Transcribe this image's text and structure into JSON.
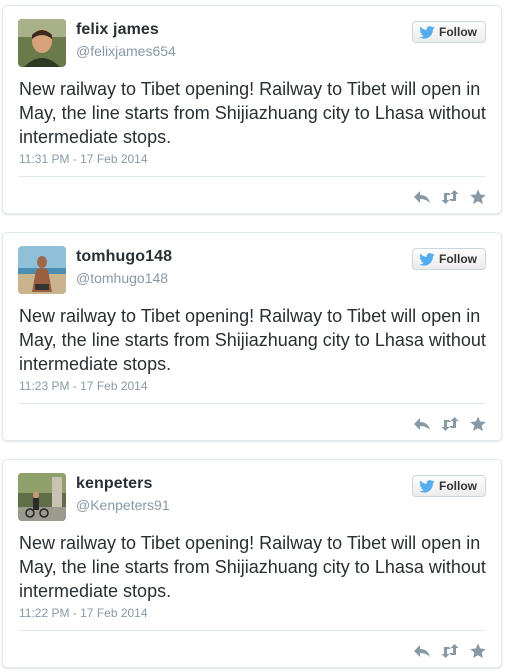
{
  "tweets": [
    {
      "name": "felix james",
      "handle": "@felixjames654",
      "follow_label": "Follow",
      "text": "New railway to Tibet opening! Railway to Tibet will open in May, the line starts from Shijiazhuang city to Lhasa without intermediate stops.",
      "time": "11:31 PM - 17 Feb 2014"
    },
    {
      "name": "tomhugo148",
      "handle": "@tomhugo148",
      "follow_label": "Follow",
      "text": "New railway to Tibet opening! Railway to Tibet will open in May, the line starts from Shijiazhuang city to Lhasa without intermediate stops.",
      "time": "11:23 PM - 17 Feb 2014"
    },
    {
      "name": "kenpeters",
      "handle": "@Kenpeters91",
      "follow_label": "Follow",
      "text": "New railway to Tibet opening! Railway to Tibet will open in May, the line starts from Shijiazhuang city to Lhasa without intermediate stops.",
      "time": "11:22 PM - 17 Feb 2014"
    }
  ],
  "colors": {
    "twitter_blue": "#55acee",
    "action_gray": "#8899a6",
    "text": "#292f33",
    "muted": "#8899a6"
  },
  "icons": [
    "twitter-bird-icon",
    "reply-icon",
    "retweet-icon",
    "favorite-icon"
  ]
}
